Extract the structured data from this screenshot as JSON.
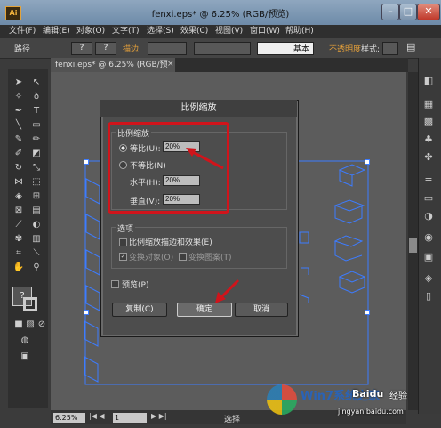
{
  "window": {
    "title": "fenxi.eps* @ 6.25% (RGB/预览)",
    "logo": "Ai"
  },
  "menu": [
    "文件(F)",
    "编辑(E)",
    "对象(O)",
    "文字(T)",
    "选择(S)",
    "效果(C)",
    "视图(V)",
    "窗口(W)",
    "帮助(H)"
  ],
  "control_bar": {
    "selection_label": "路径",
    "stroke_label": "描边:",
    "basic_label": "基本",
    "opacity_label": "不透明度",
    "style_label": "样式:",
    "fill_q": "?",
    "stroke_q": "?"
  },
  "doc_tab": {
    "label": "fenxi.eps* @ 6.25% (RGB/预览)",
    "close": "×"
  },
  "status_bar": {
    "zoom": "6.25%",
    "page": "1",
    "mode": "选择"
  },
  "dialog": {
    "title": "比例缩放",
    "scale_group_title": "比例缩放",
    "uniform_label": "等比(U):",
    "uniform_value": "20%",
    "nonuniform_label": "不等比(N)",
    "horizontal_label": "水平(H):",
    "horizontal_value": "20%",
    "vertical_label": "垂直(V):",
    "vertical_value": "20%",
    "options_title": "选项",
    "scale_strokes_label": "比例缩放描边和效果(E)",
    "transform_objects_label": "变换对象(O)",
    "transform_patterns_label": "变换图案(T)",
    "preview_label": "预览(P)",
    "copy_button": "复制(C)",
    "ok_button": "确定",
    "cancel_button": "取消"
  },
  "watermark": {
    "brand": "Win7系统之家",
    "baidu": "Baidu",
    "baidu_cn": "经验",
    "url": "jingyan.baidu.com"
  },
  "colors": {
    "highlight": "#d0141b",
    "selection": "#3d7cff"
  }
}
